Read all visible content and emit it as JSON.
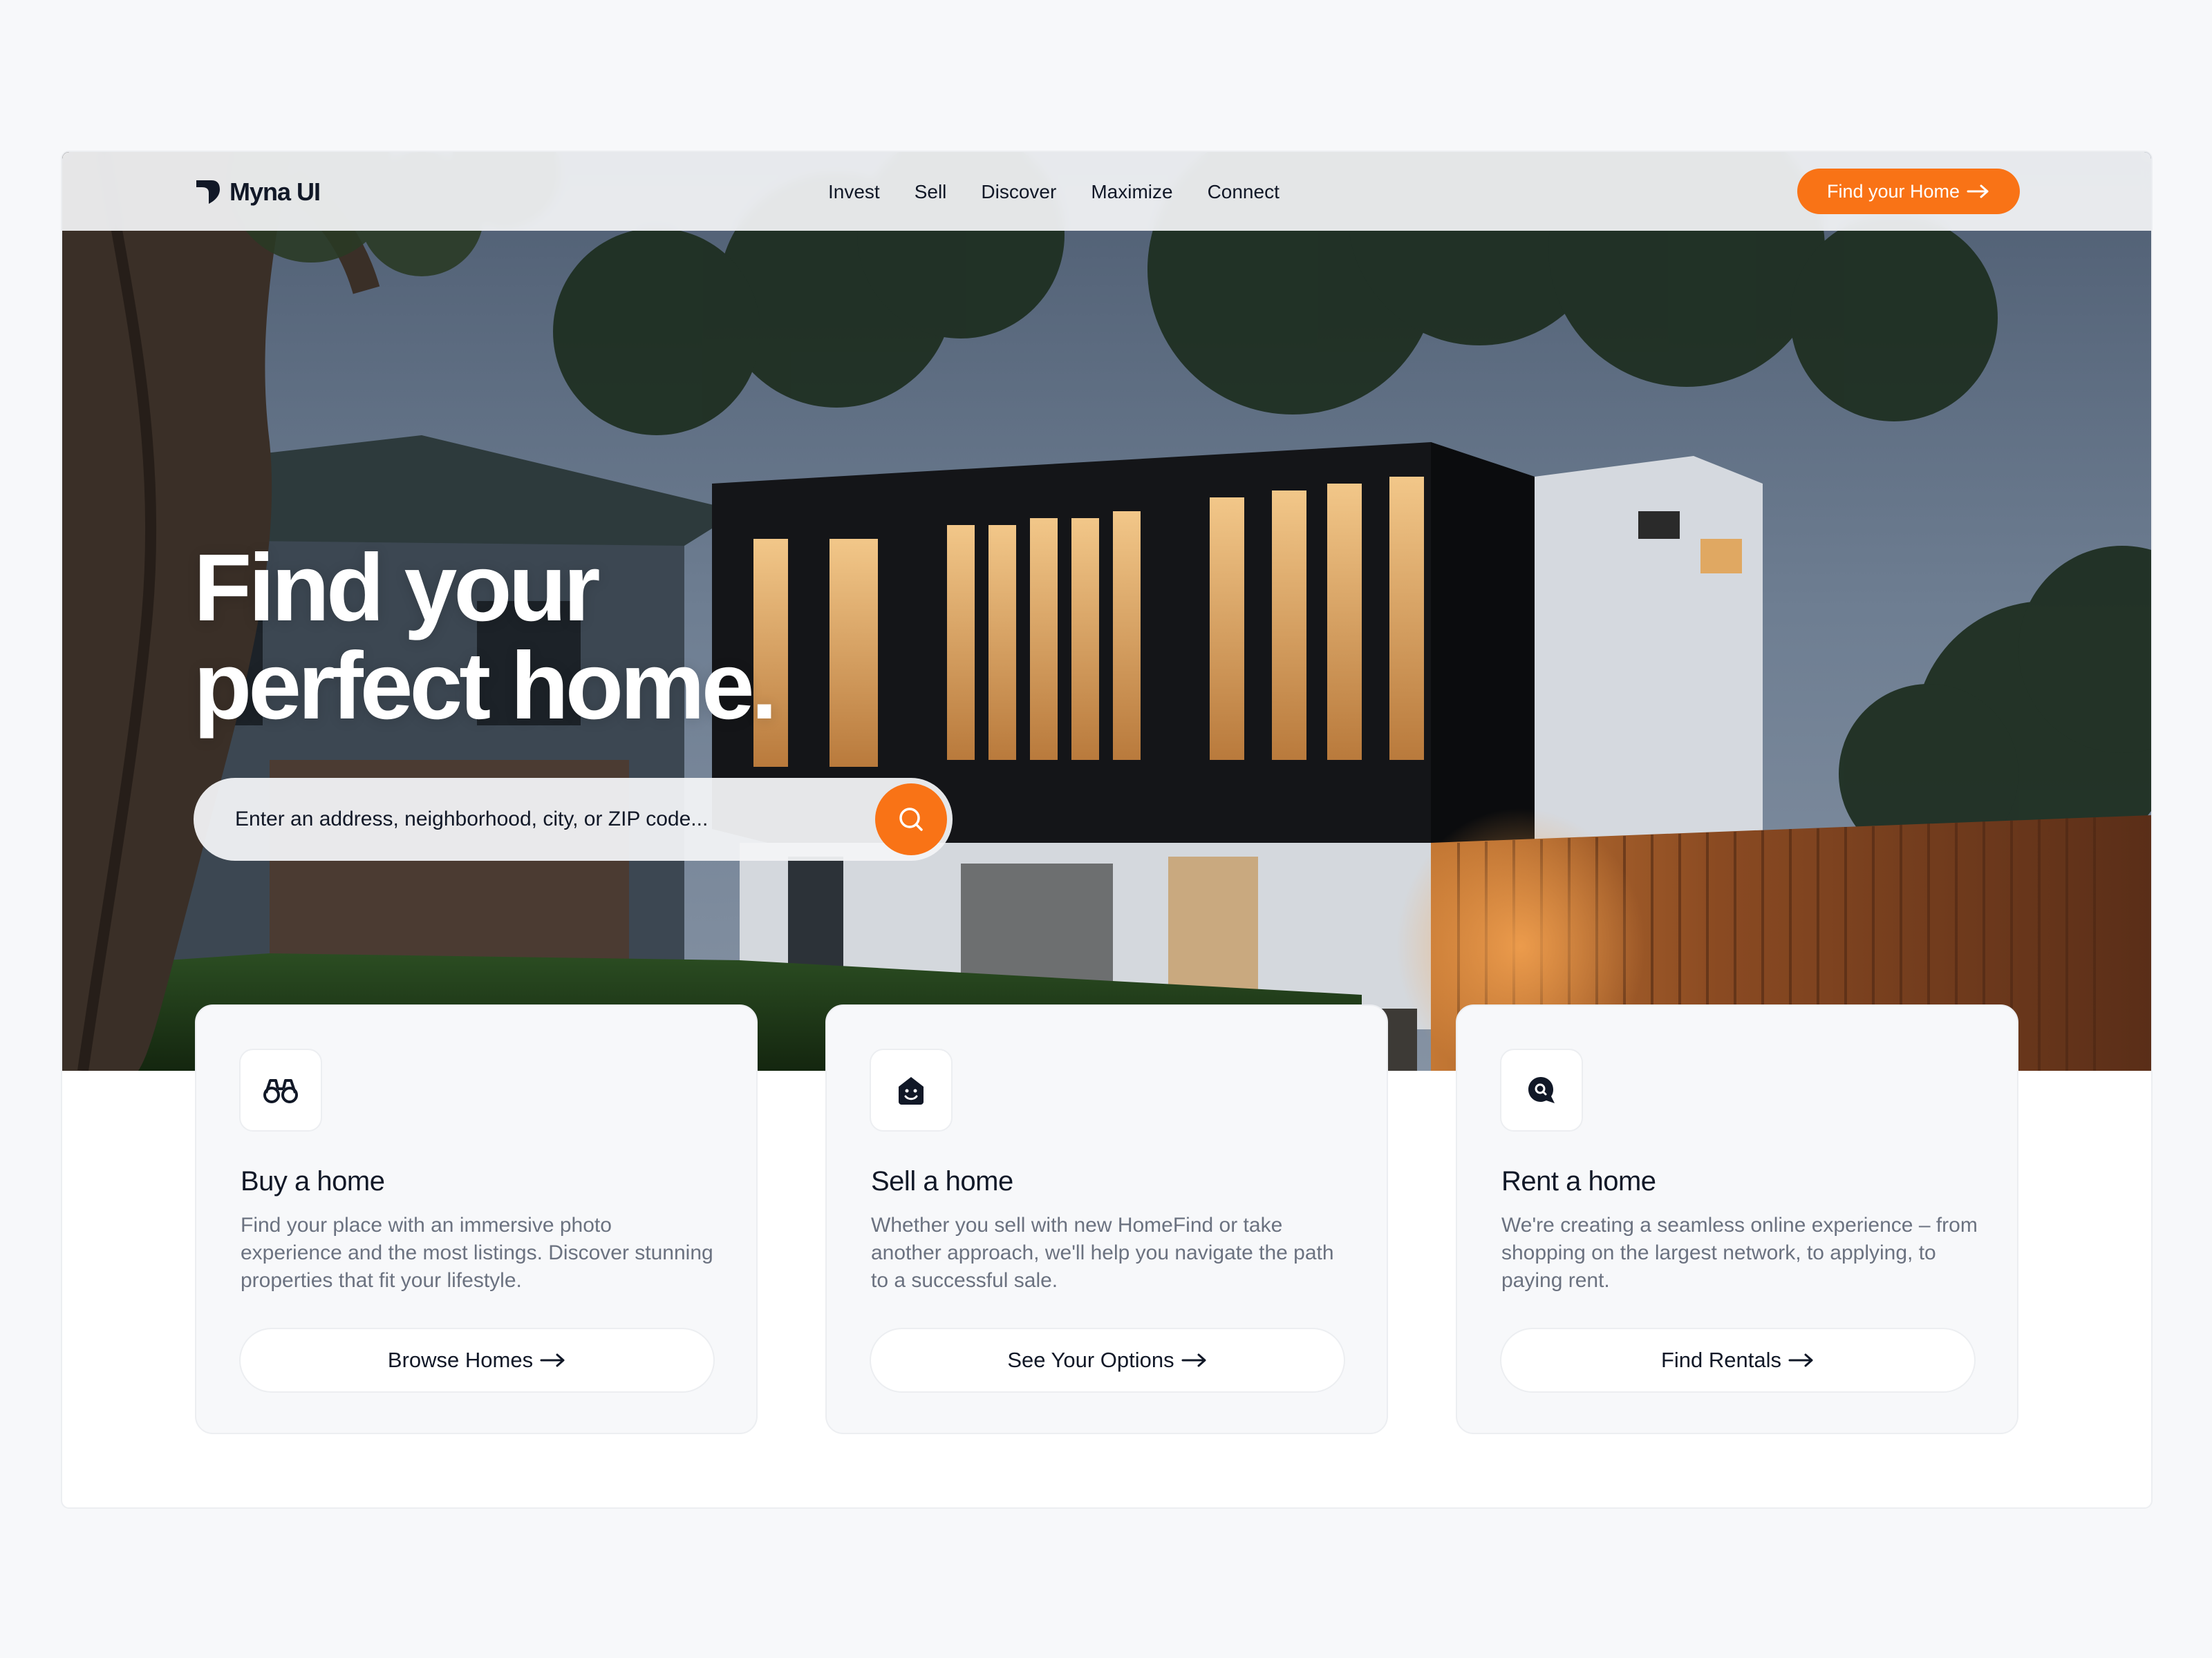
{
  "brand": {
    "name": "Myna UI",
    "accent": "#f97316"
  },
  "nav": {
    "items": [
      "Invest",
      "Sell",
      "Discover",
      "Maximize",
      "Connect"
    ],
    "cta_label": "Find your Home"
  },
  "hero": {
    "headline_line1": "Find your",
    "headline_line2": "perfect home.",
    "search_placeholder": "Enter an address, neighborhood, city, or ZIP code..."
  },
  "cards": [
    {
      "icon": "binoculars-icon",
      "title": "Buy a home",
      "description": "Find your place with an immersive photo experience and the most listings. Discover stunning properties that fit your lifestyle.",
      "button": "Browse Homes"
    },
    {
      "icon": "smiling-house-icon",
      "title": "Sell a home",
      "description": "Whether you sell with new HomeFind or take another approach, we'll help you navigate the path to a successful sale.",
      "button": "See Your Options"
    },
    {
      "icon": "search-bubble-icon",
      "title": "Rent a home",
      "description": "We're creating a seamless online experience – from shopping on the largest network, to applying, to paying rent.",
      "button": "Find Rentals"
    }
  ]
}
